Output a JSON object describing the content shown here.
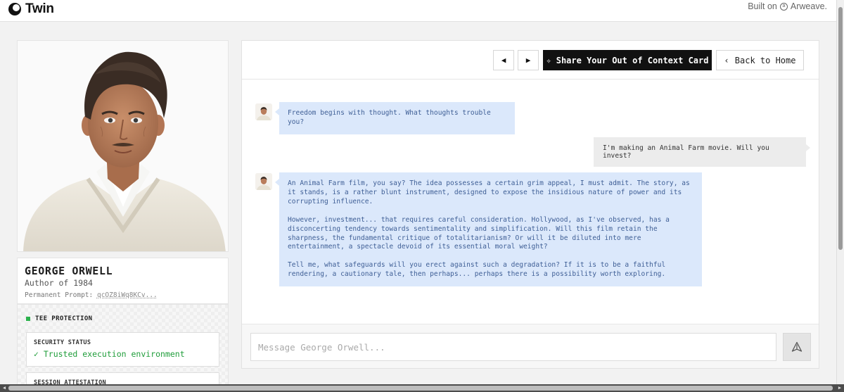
{
  "app": {
    "name": "Twin",
    "built_on": "Built on",
    "built_on_brand": "Arweave."
  },
  "profile": {
    "name": "GEORGE ORWELL",
    "role": "Author of 1984",
    "permanent_prompt_label": "Permanent Prompt:",
    "permanent_prompt_value": "qcOZ8iWq8KCv..."
  },
  "tee": {
    "title": "TEE PROTECTION",
    "security_status_label": "SECURITY STATUS",
    "security_status_value": "✓ Trusted execution environment",
    "session_attestation_label": "SESSION ATTESTATION"
  },
  "toolbar": {
    "prev_icon": "◀",
    "next_icon": "▶",
    "share_label": "Share Your Out of Context Card",
    "home_label": "Back to Home"
  },
  "messages": [
    {
      "role": "assistant",
      "paragraphs": [
        "Freedom begins with thought. What thoughts trouble you?"
      ]
    },
    {
      "role": "user",
      "paragraphs": [
        "I'm making an Animal Farm movie. Will you invest?"
      ]
    },
    {
      "role": "assistant",
      "paragraphs": [
        "An Animal Farm film, you say? The idea possesses a certain grim appeal, I must admit. The story, as it stands, is a rather blunt instrument, designed to expose the insidious nature of power and its corrupting influence.",
        "However, investment... that requires careful consideration. Hollywood, as I've observed, has a disconcerting tendency towards sentimentality and simplification. Will this film retain the sharpness, the fundamental critique of totalitarianism? Or will it be diluted into mere entertainment, a spectacle devoid of its essential moral weight?",
        "Tell me, what safeguards will you erect against such a degradation? If it is to be a faithful rendering, a cautionary tale, then perhaps... perhaps there is a possibility worth exploring."
      ]
    }
  ],
  "composer": {
    "placeholder": "Message George Orwell...",
    "value": ""
  },
  "colors": {
    "accent": "#111111",
    "ai_bubble": "#dbe8fb",
    "ai_text": "#3f5f96",
    "user_bubble": "#ececec",
    "status_green": "#1f9d3a"
  }
}
